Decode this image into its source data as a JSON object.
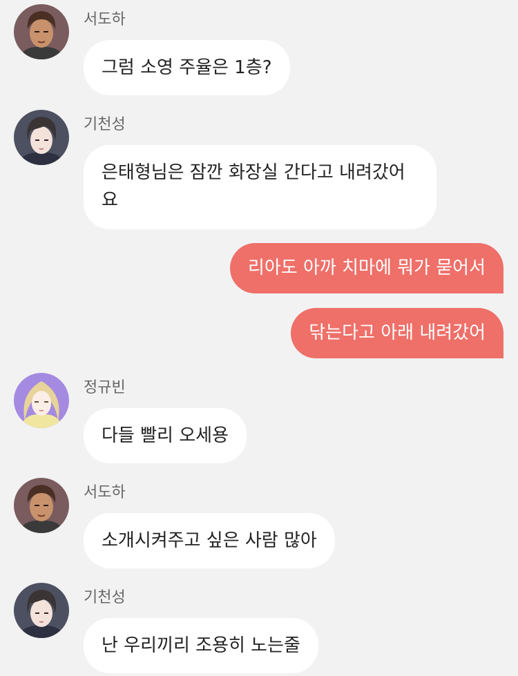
{
  "colors": {
    "background": "#f2f2f2",
    "incoming_bubble": "#ffffff",
    "outgoing_bubble": "#ee7069",
    "sender_name": "#666666"
  },
  "messages": [
    {
      "type": "incoming",
      "sender": "서도하",
      "avatar": "seodoha-avatar",
      "text": "그럼 소영 주율은 1층?"
    },
    {
      "type": "incoming",
      "sender": "기천성",
      "avatar": "gicheonseong-avatar",
      "text_line1": "은태형님은 잠깐 화장실 간다고 내려갔어",
      "text_line2": "요"
    },
    {
      "type": "outgoing",
      "text": "리아도 아까 치마에 뭐가 묻어서"
    },
    {
      "type": "outgoing",
      "text": "닦는다고 아래 내려갔어"
    },
    {
      "type": "incoming",
      "sender": "정규빈",
      "avatar": "jeonggyubin-avatar",
      "text": "다들 빨리 오세용"
    },
    {
      "type": "incoming",
      "sender": "서도하",
      "avatar": "seodoha-avatar",
      "text": "소개시켜주고 싶은 사람 많아"
    },
    {
      "type": "incoming",
      "sender": "기천성",
      "avatar": "gicheonseong-avatar",
      "text": "난 우리끼리 조용히 노는줄"
    }
  ]
}
